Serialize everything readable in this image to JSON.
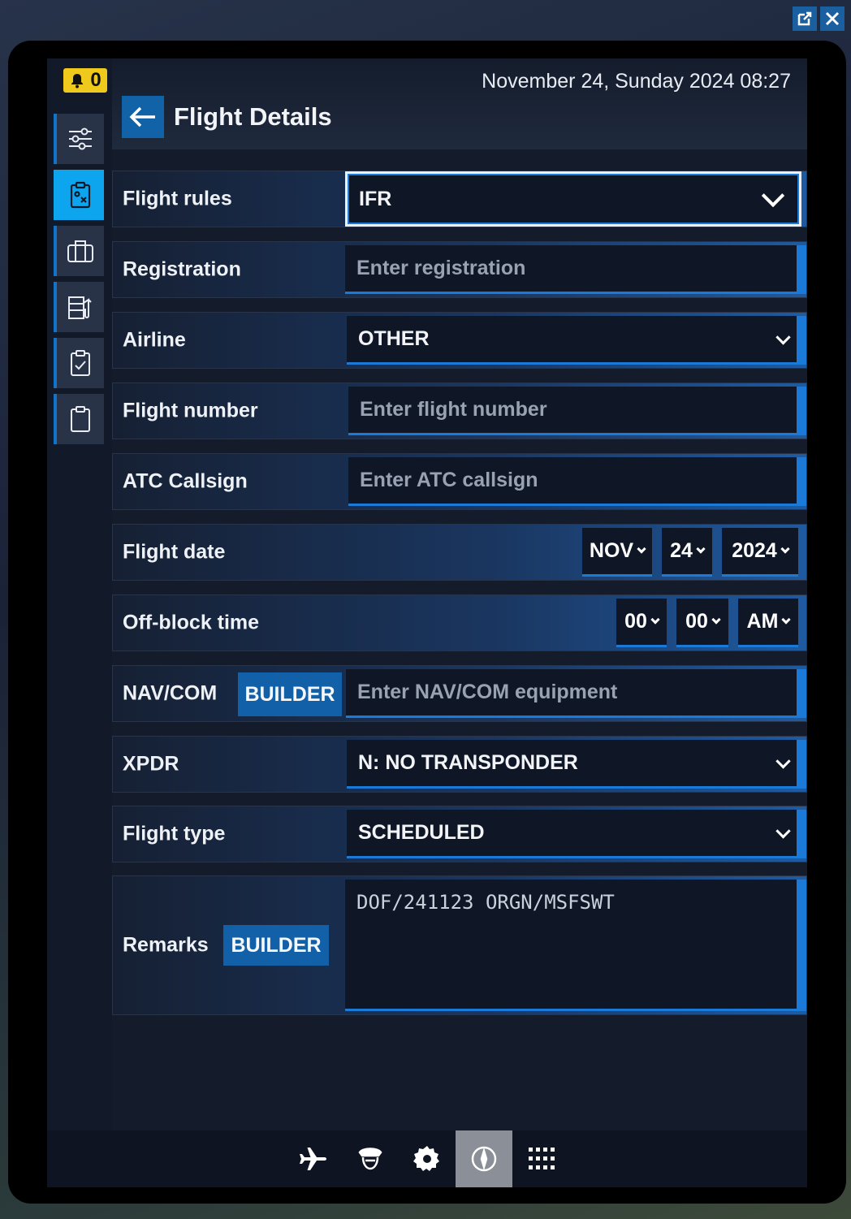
{
  "notifications": {
    "count": "0"
  },
  "header": {
    "datetime": "November 24, Sunday 2024 08:27",
    "title": "Flight Details"
  },
  "sidebar": {
    "items": [
      {
        "name": "settings-sliders",
        "active": false
      },
      {
        "name": "flight-plan-clipboard",
        "active": true
      },
      {
        "name": "briefcase",
        "active": false
      },
      {
        "name": "fuel-station",
        "active": false
      },
      {
        "name": "checklist",
        "active": false
      },
      {
        "name": "clipboard",
        "active": false
      }
    ]
  },
  "form": {
    "flight_rules": {
      "label": "Flight rules",
      "value": "IFR"
    },
    "registration": {
      "label": "Registration",
      "placeholder": "Enter registration"
    },
    "airline": {
      "label": "Airline",
      "value": "OTHER"
    },
    "flight_number": {
      "label": "Flight number",
      "placeholder": "Enter flight number"
    },
    "atc_callsign": {
      "label": "ATC Callsign",
      "placeholder": "Enter ATC callsign"
    },
    "flight_date": {
      "label": "Flight date",
      "month": "NOV",
      "day": "24",
      "year": "2024"
    },
    "off_block": {
      "label": "Off-block time",
      "hour": "00",
      "minute": "00",
      "ampm": "AM"
    },
    "navcom": {
      "label": "NAV/COM",
      "builder": "BUILDER",
      "placeholder": "Enter NAV/COM equipment"
    },
    "xpdr": {
      "label": "XPDR",
      "value": "N: NO TRANSPONDER"
    },
    "flight_type": {
      "label": "Flight type",
      "value": "SCHEDULED"
    },
    "remarks": {
      "label": "Remarks",
      "builder": "BUILDER",
      "value": "DOF/241123 ORGN/MSFSWT"
    }
  },
  "bottom_nav": [
    "airplane-icon",
    "pilot-icon",
    "gear-icon",
    "compass-icon",
    "apps-grid-icon"
  ],
  "colors": {
    "accent": "#1b7ad8",
    "active_tab": "#0ea5ef",
    "badge": "#f0c91d"
  }
}
